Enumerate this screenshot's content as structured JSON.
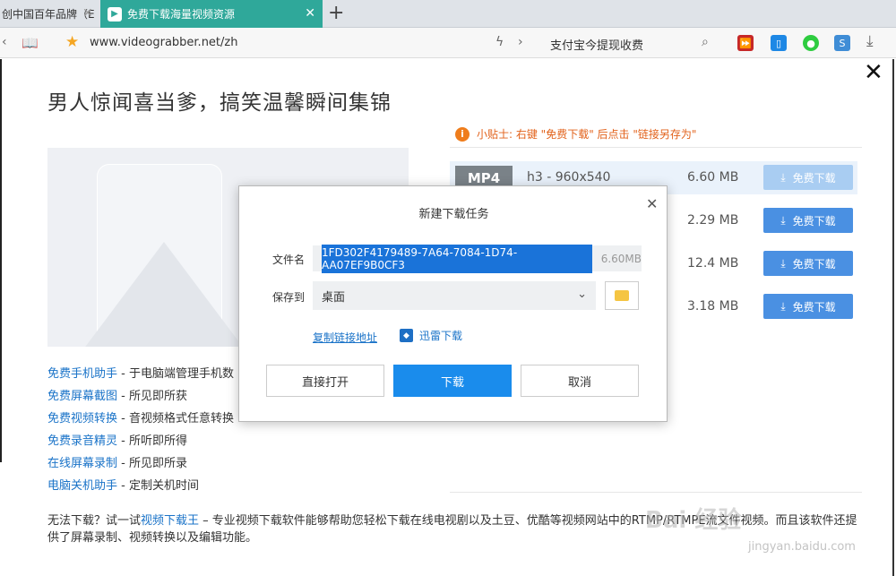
{
  "browser": {
    "tabs": [
      {
        "label": "创中国百年品牌（E",
        "active": false
      },
      {
        "label": "免费下载海量视频资源",
        "active": true
      }
    ],
    "url": "www.videograbber.net/zh",
    "search_text": "支付宝今提现收费"
  },
  "page": {
    "title": "男人惊闻喜当爹，搞笑温馨瞬间集锦",
    "tip": "小贴士: 右键 \"免费下载\" 后点击 \"链接另存为\"",
    "downloads": [
      {
        "format": "MP4",
        "resolution": "h3 - 960x540",
        "size": "6.60 MB",
        "button": "免费下载"
      },
      {
        "format": "",
        "resolution": "",
        "size": "2.29 MB",
        "button": "免费下载"
      },
      {
        "format": "",
        "resolution": "",
        "size": "12.4 MB",
        "button": "免费下载"
      },
      {
        "format": "",
        "resolution": "",
        "size": "3.18 MB",
        "button": "免费下载"
      }
    ],
    "links": [
      {
        "name": "免费手机助手",
        "desc": " - 于电脑端管理手机数"
      },
      {
        "name": "免费屏幕截图",
        "desc": " - 所见即所获"
      },
      {
        "name": "免费视频转换",
        "desc": " - 音视频格式任意转换"
      },
      {
        "name": "免费录音精灵",
        "desc": " - 所听即所得"
      },
      {
        "name": "在线屏幕录制",
        "desc": " - 所见即所录"
      },
      {
        "name": "电脑关机助手",
        "desc": " - 定制关机时间"
      }
    ],
    "bottom": {
      "prefix": "无法下载？试一试",
      "link": "视频下载王",
      "suffix": " – 专业视频下载软件能够帮助您轻松下载在线电视剧以及土豆、优酷等视频网站中的RTMP/RTMPE流文件视频。而且该软件还提供了屏幕录制、视频转换以及编辑功能。"
    }
  },
  "dialog": {
    "title": "新建下载任务",
    "filename_label": "文件名",
    "filename": "1FD302F4179489-7A64-7084-1D74-AA07EF9B0CF3",
    "filesize": "6.60MB",
    "save_label": "保存到",
    "save_location": "桌面",
    "copy_link": "复制链接地址",
    "thunder": "迅雷下载",
    "buttons": {
      "open": "直接打开",
      "download": "下载",
      "cancel": "取消"
    }
  },
  "watermark": {
    "text": "Bai 经验",
    "url": "jingyan.baidu.com"
  }
}
